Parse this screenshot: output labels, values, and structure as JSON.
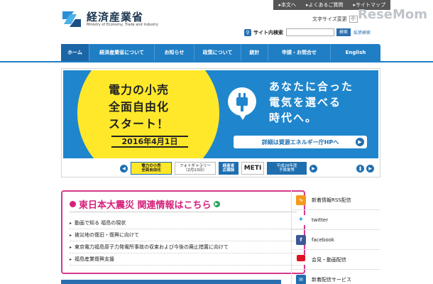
{
  "topbar": [
    "本文へ",
    "よくあるご質問",
    "サイトマップ"
  ],
  "logo": {
    "jp": "経済産業省",
    "en": "Ministry of Economy, Trade and Industry"
  },
  "watermark": "ReseMom",
  "fontsize": {
    "label": "文字サイズ変更",
    "value": "小"
  },
  "search": {
    "label": "サイト内検索",
    "placeholder": "",
    "button": "検索",
    "advanced": "拡張検索"
  },
  "nav": [
    "ホーム",
    "経済産業省について",
    "お知らせ",
    "政策について",
    "統計",
    "申請・お問合せ",
    "English"
  ],
  "hero": {
    "line1": "電力の小売",
    "line2": "全面自由化",
    "line3": "スタート！",
    "date": "2016年4月1日",
    "msg1": "あなたに合った",
    "msg2": "電気を選べる",
    "msg3": "時代へ。",
    "button": "詳細は資源エネルギー庁HPへ"
  },
  "thumbs": {
    "t1": "電力の小売\n全面自由化",
    "t2": "フォトギャラリー\n（2月13日）",
    "t3": "経産省\n広報誌",
    "t4": "METI",
    "t5": "平成28年度\n予算案等"
  },
  "quake": {
    "title": "東日本大震災 関連情報はこちら",
    "items": [
      "動画で知る 福島の現状",
      "被災地の復旧・復興に向けて",
      "東京電力福島原子力発電所事故の収束および今後の廃止措置に向けて",
      "福島産業復興支援"
    ]
  },
  "side": [
    "新着情報RSS配信",
    "twitter",
    "facebook",
    "会見・動画配信",
    "新着配信サービス"
  ],
  "colors": {
    "accent": "#1f7ec4",
    "yellow": "#ffe82a",
    "magenta": "#d6207a"
  }
}
